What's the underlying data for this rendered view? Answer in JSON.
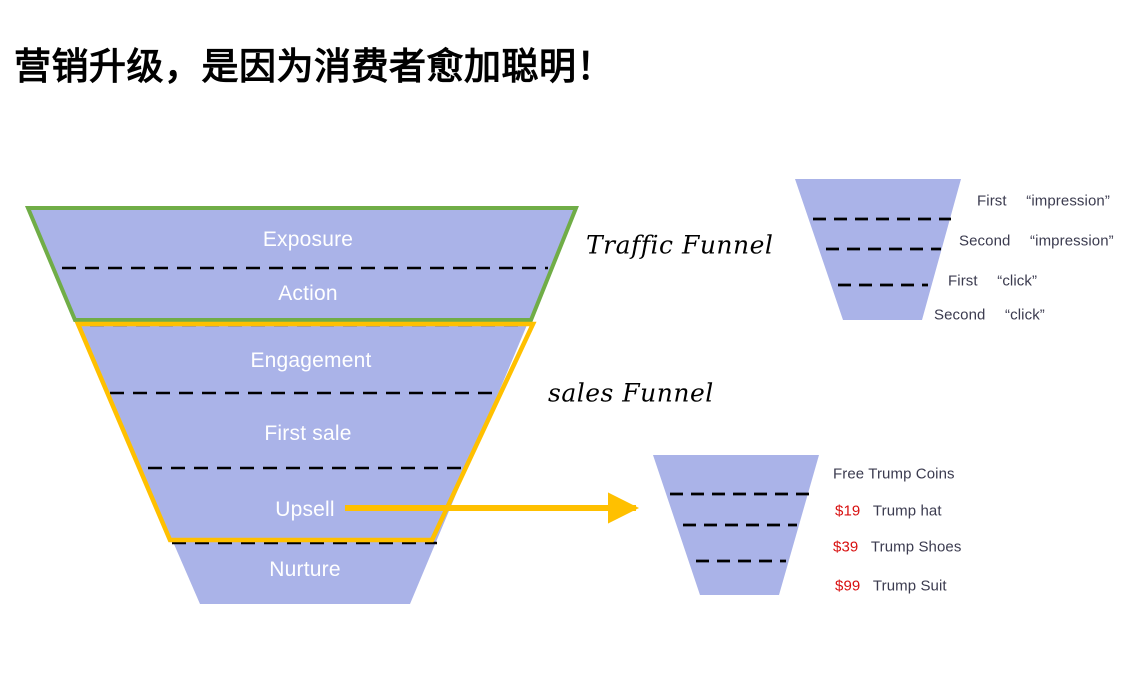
{
  "slide": {
    "title": "营销升级，是因为消费者愈加聪明！",
    "background_color": "#ffffff"
  },
  "colors": {
    "funnel_fill": "#aab3e8",
    "traffic_outline": "#70ad47",
    "sales_outline": "#ffc000",
    "divider": "#000000",
    "stage_text": "#ffffff",
    "legend_text": "#3b3b4f",
    "price_text": "#d81010",
    "arrow": "#ffc000"
  },
  "main_funnel": {
    "name": "main-marketing-funnel",
    "stages": [
      {
        "label": "Exposure",
        "group": "traffic"
      },
      {
        "label": "Action",
        "group": "traffic"
      },
      {
        "label": "Engagement",
        "group": "sales"
      },
      {
        "label": "First sale",
        "group": "sales"
      },
      {
        "label": "Upsell",
        "group": "sales"
      },
      {
        "label": "Nurture",
        "group": "sales"
      }
    ]
  },
  "annotations": {
    "traffic_funnel": "Traffic Funnel",
    "sales_funnel": "sales Funnel"
  },
  "traffic_detail_funnel": {
    "name": "traffic-detail-funnel",
    "rows": [
      {
        "ordinal": "First",
        "term": "“impression”"
      },
      {
        "ordinal": "Second",
        "term": "“impression”"
      },
      {
        "ordinal": "First",
        "term": "“click”"
      },
      {
        "ordinal": "Second",
        "term": "“click”"
      }
    ]
  },
  "sales_detail_funnel": {
    "name": "sales-detail-funnel",
    "rows": [
      {
        "price": "",
        "product": "Free Trump Coins"
      },
      {
        "price": "$19",
        "product": "Trump hat"
      },
      {
        "price": "$39",
        "product": "Trump Shoes"
      },
      {
        "price": "$99",
        "product": "Trump Suit"
      }
    ]
  }
}
